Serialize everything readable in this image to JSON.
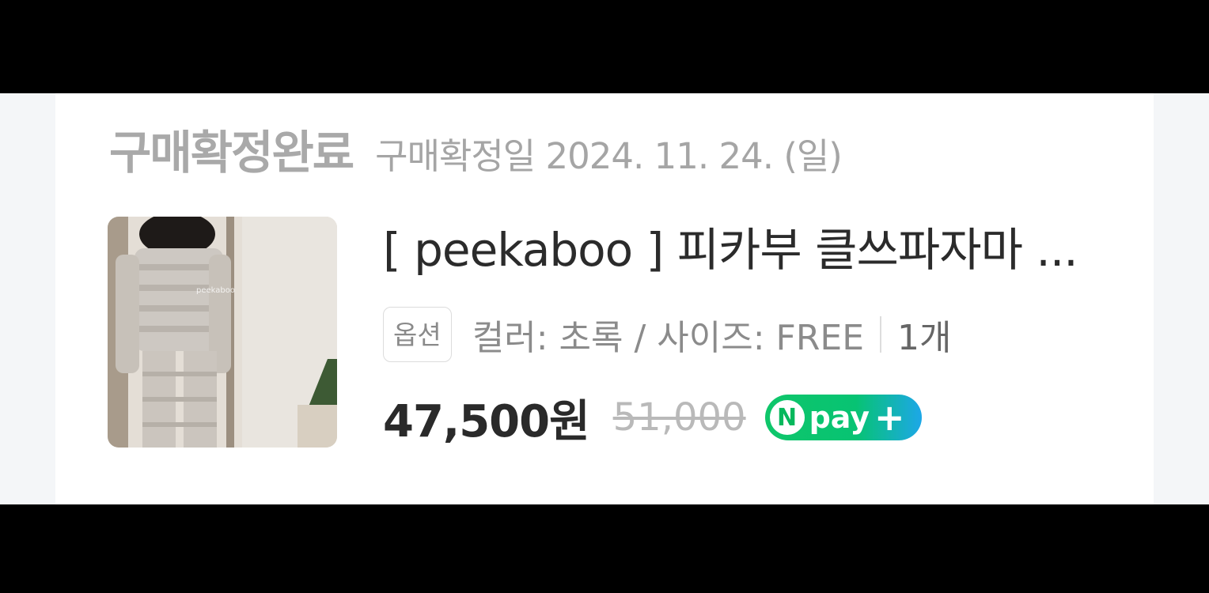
{
  "order": {
    "status": "구매확정완료",
    "confirm_date": "구매확정일 2024. 11. 24. (일)"
  },
  "product": {
    "name": "[ peekaboo ] 피카부 클쓰파자마 ...",
    "image_watermark": "peekaboo",
    "option_tag": "옵션",
    "option_text": "컬러: 초록 / 사이즈: FREE",
    "quantity": "1개",
    "price": "47,500원",
    "original_price": "51,000",
    "payment_badge": {
      "n_letter": "N",
      "label": "pay",
      "plus": "+",
      "colors": [
        "#03c75a",
        "#1da7e8"
      ]
    }
  }
}
